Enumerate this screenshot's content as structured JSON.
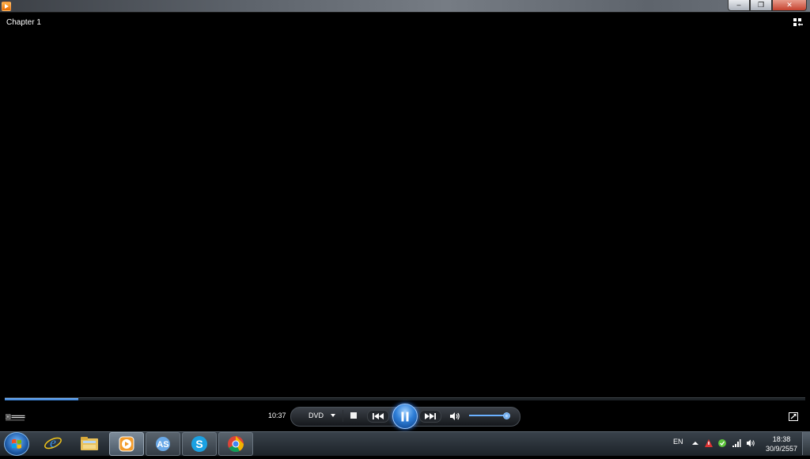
{
  "window": {
    "title_visible": "",
    "controls": {
      "minimize": "‒",
      "maximize": "❐",
      "close": "✕"
    }
  },
  "player": {
    "chapter_label": "Chapter 1",
    "elapsed_time": "10:37",
    "source_label": "DVD",
    "seek_progress": 0.092,
    "volume_level": 0.95,
    "colors": {
      "accent": "#2f7fd8",
      "background": "#000000"
    },
    "icons": {
      "switch_to_library": "switch-library-icon",
      "dolby": "dolby-logo",
      "stop": "stop-icon",
      "previous": "previous-icon",
      "play_pause": "pause-icon",
      "next": "next-icon",
      "volume": "speaker-icon",
      "fullscreen": "fullscreen-icon"
    }
  },
  "taskbar": {
    "items": [
      {
        "name": "internet-explorer",
        "state": "pinned"
      },
      {
        "name": "file-explorer",
        "state": "pinned"
      },
      {
        "name": "windows-media-player",
        "state": "active"
      },
      {
        "name": "as-app",
        "state": "running"
      },
      {
        "name": "skype",
        "state": "running"
      },
      {
        "name": "chrome",
        "state": "pinned"
      }
    ],
    "language": "EN",
    "clock": {
      "time": "18:38",
      "date": "30/9/2557"
    }
  }
}
